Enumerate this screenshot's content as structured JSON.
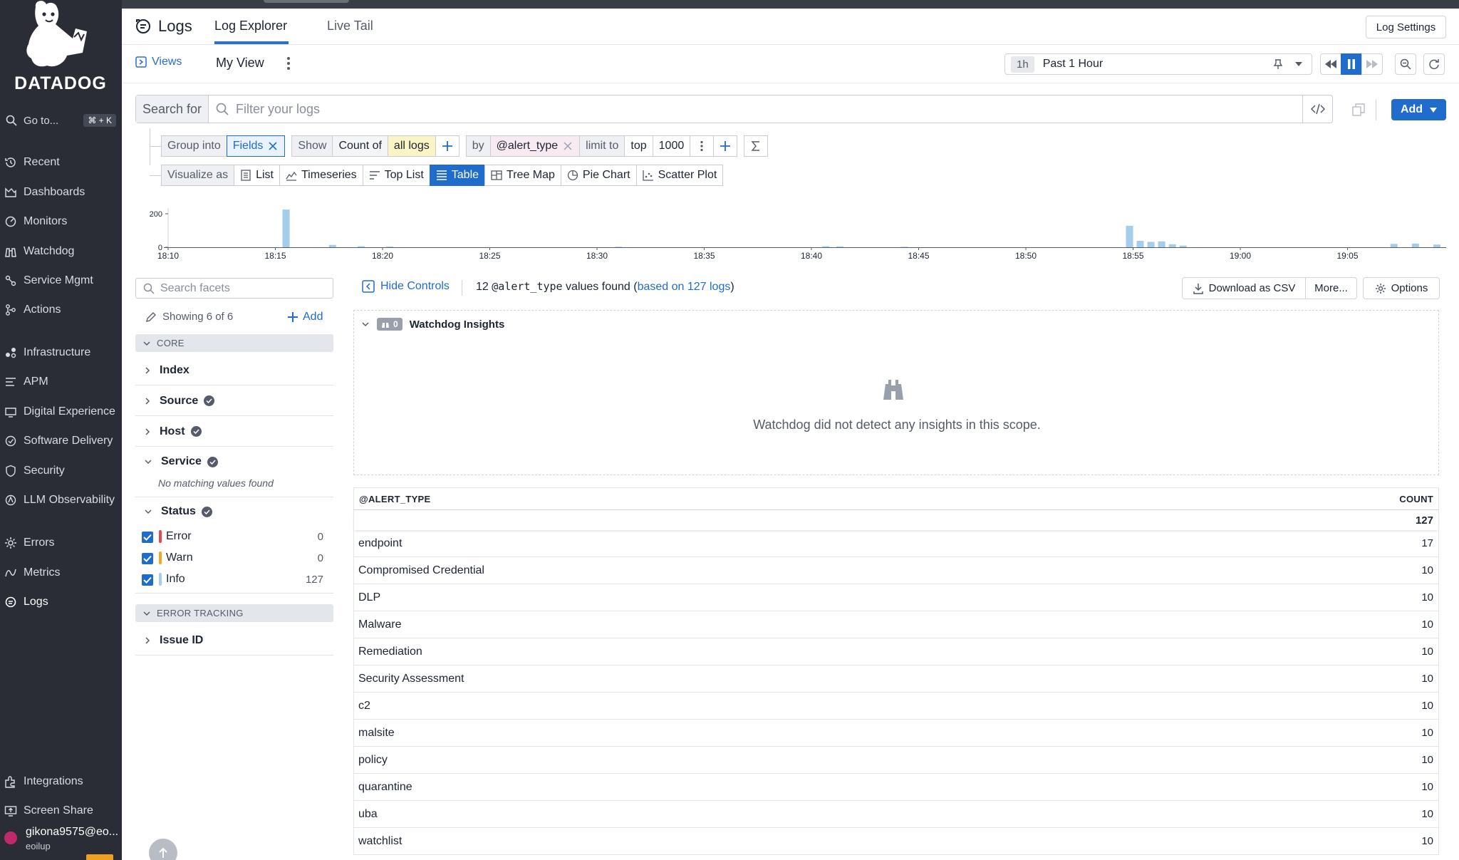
{
  "sidebar": {
    "brand": "DATADOG",
    "goto_label": "Go to...",
    "goto_shortcut": "⌘ + K",
    "items": [
      {
        "label": "Recent",
        "icon": "history-icon"
      },
      {
        "label": "Dashboards",
        "icon": "dashboard-icon"
      },
      {
        "label": "Monitors",
        "icon": "monitor-icon"
      },
      {
        "label": "Watchdog",
        "icon": "binoculars-icon"
      },
      {
        "label": "Service Mgmt",
        "icon": "service-icon"
      },
      {
        "label": "Actions",
        "icon": "actions-icon"
      },
      {
        "label": "Infrastructure",
        "icon": "infrastructure-icon"
      },
      {
        "label": "APM",
        "icon": "apm-icon"
      },
      {
        "label": "Digital Experience",
        "icon": "globe-icon"
      },
      {
        "label": "Software Delivery",
        "icon": "delivery-icon"
      },
      {
        "label": "Security",
        "icon": "shield-icon"
      },
      {
        "label": "LLM Observability",
        "icon": "llm-icon"
      },
      {
        "label": "Errors",
        "icon": "errors-icon"
      },
      {
        "label": "Metrics",
        "icon": "metrics-icon"
      },
      {
        "label": "Logs",
        "icon": "logs-icon"
      },
      {
        "label": "Integrations",
        "icon": "puzzle-icon"
      },
      {
        "label": "Screen Share",
        "icon": "screen-share-icon"
      }
    ],
    "user": {
      "email": "gikona9575@eo...",
      "org": "eoilup"
    }
  },
  "header": {
    "title": "Logs",
    "tabs": [
      "Log Explorer",
      "Live Tail"
    ],
    "active_tab": "Log Explorer",
    "settings_label": "Log Settings",
    "views_label": "Views",
    "view_name": "My View",
    "time_pill": "1h",
    "time_label": "Past 1 Hour"
  },
  "search": {
    "prefix": "Search for",
    "placeholder": "Filter your logs",
    "add_label": "Add"
  },
  "query": {
    "group_into": "Group into",
    "fields": "Fields",
    "show": "Show",
    "count_of": "Count of",
    "all_logs": "all logs",
    "by": "by",
    "by_field": "@alert_type",
    "limit_to": "limit to",
    "top": "top",
    "limit": "1000",
    "visualize_as": "Visualize as",
    "viz": [
      "List",
      "Timeseries",
      "Top List",
      "Table",
      "Tree Map",
      "Pie Chart",
      "Scatter Plot"
    ],
    "viz_selected": "Table"
  },
  "chart_data": {
    "type": "bar",
    "ylim": [
      0,
      200
    ],
    "yticks": [
      "0",
      "200"
    ],
    "xticks": [
      "18:10",
      "18:15",
      "18:20",
      "18:25",
      "18:30",
      "18:35",
      "18:40",
      "18:45",
      "18:50",
      "18:55",
      "19:00",
      "19:05"
    ],
    "color": "#a3cde8",
    "bars": [
      {
        "t": "18:15:30",
        "value": 225
      },
      {
        "t": "18:17:40",
        "value": 14
      },
      {
        "t": "18:19:00",
        "value": 6
      },
      {
        "t": "18:20:20",
        "value": 4
      },
      {
        "t": "18:31:00",
        "value": 3
      },
      {
        "t": "18:40:40",
        "value": 6
      },
      {
        "t": "18:41:20",
        "value": 5
      },
      {
        "t": "18:44:20",
        "value": 3
      },
      {
        "t": "18:54:50",
        "value": 128
      },
      {
        "t": "18:55:20",
        "value": 38
      },
      {
        "t": "18:55:50",
        "value": 32
      },
      {
        "t": "18:56:20",
        "value": 35
      },
      {
        "t": "18:56:50",
        "value": 18
      },
      {
        "t": "18:57:20",
        "value": 10
      },
      {
        "t": "19:07:10",
        "value": 20
      },
      {
        "t": "19:08:10",
        "value": 22
      },
      {
        "t": "19:09:10",
        "value": 16
      }
    ]
  },
  "facets": {
    "search_placeholder": "Search facets",
    "showing": "Showing 6 of 6",
    "add_label": "Add",
    "core_label": "CORE",
    "items": [
      "Index",
      "Source",
      "Host",
      "Service"
    ],
    "service_empty": "No matching values found",
    "status_label": "Status",
    "statuses": [
      {
        "label": "Error",
        "count": "0",
        "color": "#e5484d"
      },
      {
        "label": "Warn",
        "count": "0",
        "color": "#f5a524"
      },
      {
        "label": "Info",
        "count": "127",
        "color": "#a3cde8"
      }
    ],
    "error_tracking_label": "ERROR TRACKING",
    "issue_id": "Issue ID"
  },
  "results": {
    "hide_controls": "Hide Controls",
    "found_prefix": "12",
    "found_field": "@alert_type",
    "found_mid": "values found (",
    "found_link": "based on 127 logs",
    "found_suffix": ")",
    "download_csv": "Download as CSV",
    "more": "More...",
    "options": "Options"
  },
  "watchdog": {
    "title": "Watchdog Insights",
    "count": "0",
    "message": "Watchdog did not detect any insights in this scope."
  },
  "table": {
    "col_type": "@ALERT_TYPE",
    "col_count": "COUNT",
    "total": "127",
    "rows": [
      {
        "type": "endpoint",
        "count": "17"
      },
      {
        "type": "Compromised Credential",
        "count": "10"
      },
      {
        "type": "DLP",
        "count": "10"
      },
      {
        "type": "Malware",
        "count": "10"
      },
      {
        "type": "Remediation",
        "count": "10"
      },
      {
        "type": "Security Assessment",
        "count": "10"
      },
      {
        "type": "c2",
        "count": "10"
      },
      {
        "type": "malsite",
        "count": "10"
      },
      {
        "type": "policy",
        "count": "10"
      },
      {
        "type": "quarantine",
        "count": "10"
      },
      {
        "type": "uba",
        "count": "10"
      },
      {
        "type": "watchlist",
        "count": "10"
      }
    ]
  }
}
